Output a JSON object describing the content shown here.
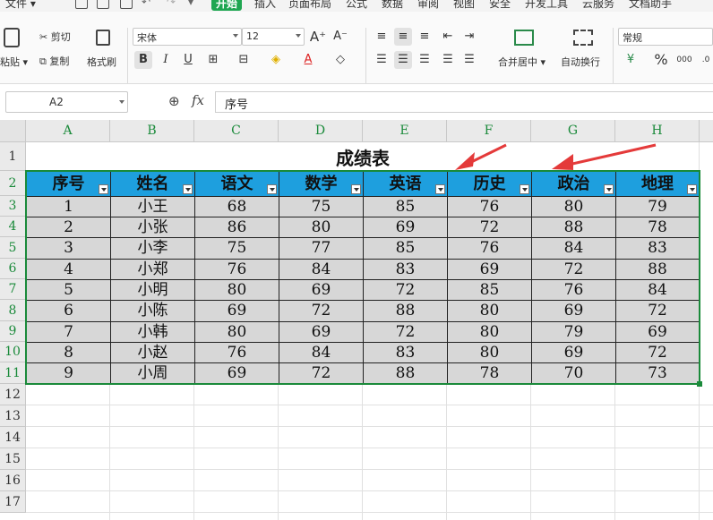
{
  "menubar": {
    "file": "文件",
    "tabs": [
      "开始",
      "插入",
      "页面布局",
      "公式",
      "数据",
      "审阅",
      "视图",
      "安全",
      "开发工具",
      "云服务",
      "文档助手"
    ],
    "active_tab": "开始"
  },
  "ribbon": {
    "paste": "粘贴",
    "cut": "剪切",
    "copy": "复制",
    "format_painter": "格式刷",
    "font_name": "宋体",
    "font_size": "12",
    "bold": "B",
    "italic": "I",
    "underline": "U",
    "increase_font": "A⁺",
    "decrease_font": "A⁻",
    "merge_center": "合并居中",
    "wrap_text": "自动换行",
    "number_format": "常规",
    "percent": "%",
    "thousands": "000"
  },
  "formulabar": {
    "name_box": "A2",
    "fx": "fx",
    "content": "序号"
  },
  "grid": {
    "columns": [
      "A",
      "B",
      "C",
      "D",
      "E",
      "F",
      "G",
      "H"
    ],
    "rows": [
      "1",
      "2",
      "3",
      "4",
      "5",
      "6",
      "7",
      "8",
      "9",
      "10",
      "11",
      "12",
      "13",
      "14",
      "15",
      "16",
      "17"
    ],
    "title": "成绩表",
    "headers": [
      "序号",
      "姓名",
      "语文",
      "数学",
      "英语",
      "历史",
      "政治",
      "地理"
    ],
    "data": [
      [
        "1",
        "小王",
        "68",
        "75",
        "85",
        "76",
        "80",
        "79"
      ],
      [
        "2",
        "小张",
        "86",
        "80",
        "69",
        "72",
        "88",
        "78"
      ],
      [
        "3",
        "小李",
        "75",
        "77",
        "85",
        "76",
        "84",
        "83"
      ],
      [
        "4",
        "小郑",
        "76",
        "84",
        "83",
        "69",
        "72",
        "88"
      ],
      [
        "5",
        "小明",
        "80",
        "69",
        "72",
        "85",
        "76",
        "84"
      ],
      [
        "6",
        "小陈",
        "69",
        "72",
        "88",
        "80",
        "69",
        "72"
      ],
      [
        "7",
        "小韩",
        "80",
        "69",
        "72",
        "80",
        "79",
        "69"
      ],
      [
        "8",
        "小赵",
        "76",
        "84",
        "83",
        "80",
        "69",
        "72"
      ],
      [
        "9",
        "小周",
        "69",
        "72",
        "88",
        "78",
        "70",
        "73"
      ]
    ]
  },
  "colors": {
    "header_fill": "#1e9fde",
    "data_fill": "#d7d7d7",
    "selection": "#1a8a3a",
    "arrow": "#e43a3a"
  }
}
